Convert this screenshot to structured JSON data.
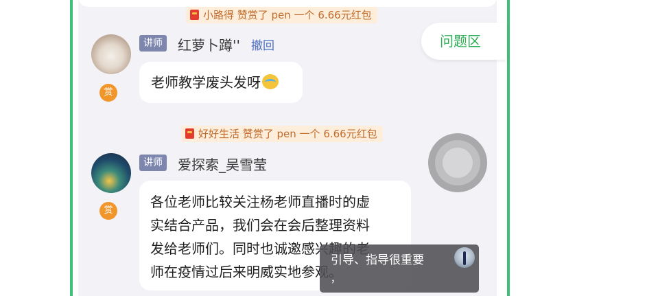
{
  "gift_banners": [
    {
      "text": "小路得 赞赏了 pen 一个 6.66元红包"
    },
    {
      "text": "好好生活 赞赏了 pen 一个 6.66元红包"
    }
  ],
  "messages": [
    {
      "role_badge": "讲师",
      "username": "红萝卜蹲''",
      "recall_label": "撤回",
      "reward_badge": "赏",
      "text": "老师教学废头发呀",
      "emoji_icon": "crying-laughing-emoji"
    },
    {
      "role_badge": "讲师",
      "username": "爱探索_吴雪莹",
      "reward_badge": "赏",
      "lines": [
        "各位老师比较关注杨老师直播时的虚",
        "实结合产品，我们会在会后整理资料",
        "发给老师们。同时也诚邀感兴趣的老",
        "师在疫情过后来明威实地参观。"
      ]
    }
  ],
  "question_area_button": "问题区",
  "subtitle_overlay": {
    "text": "引导、指导很重要",
    "comma": "，"
  },
  "colors": {
    "frame_border": "#3fbf77",
    "question_text": "#2eae55",
    "recall_link": "#4a6bc0",
    "role_badge_bg": "#7d86ad",
    "reward_badge_bg": "#f0962b",
    "gift_text": "#c06a2b"
  }
}
